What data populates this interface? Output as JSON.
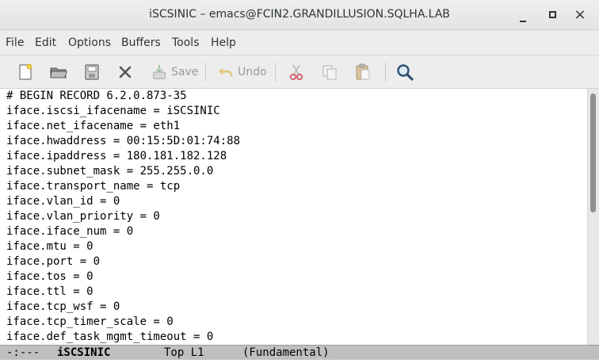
{
  "window": {
    "title": "iSCSINIC – emacs@FCIN2.GRANDILLUSION.SQLHA.LAB"
  },
  "menubar": {
    "items": [
      "File",
      "Edit",
      "Options",
      "Buffers",
      "Tools",
      "Help"
    ]
  },
  "toolbar": {
    "save_label": "Save",
    "undo_label": "Undo"
  },
  "editor": {
    "lines": [
      "# BEGIN RECORD 6.2.0.873-35",
      "iface.iscsi_ifacename = iSCSINIC",
      "iface.net_ifacename = eth1",
      "iface.hwaddress = 00:15:5D:01:74:88",
      "iface.ipaddress = 180.181.182.128",
      "iface.subnet_mask = 255.255.0.0",
      "iface.transport_name = tcp",
      "iface.vlan_id = 0",
      "iface.vlan_priority = 0",
      "iface.iface_num = 0",
      "iface.mtu = 0",
      "iface.port = 0",
      "iface.tos = 0",
      "iface.ttl = 0",
      "iface.tcp_wsf = 0",
      "iface.tcp_timer_scale = 0",
      "iface.def_task_mgmt_timeout = 0"
    ]
  },
  "modeline": {
    "status": "-:---",
    "buffer": "iSCSINIC",
    "position": "Top L1",
    "mode": "(Fundamental)"
  },
  "colors": {
    "modeline_bg": "#bfbfbf",
    "toolbar_bg": "#ededed"
  }
}
